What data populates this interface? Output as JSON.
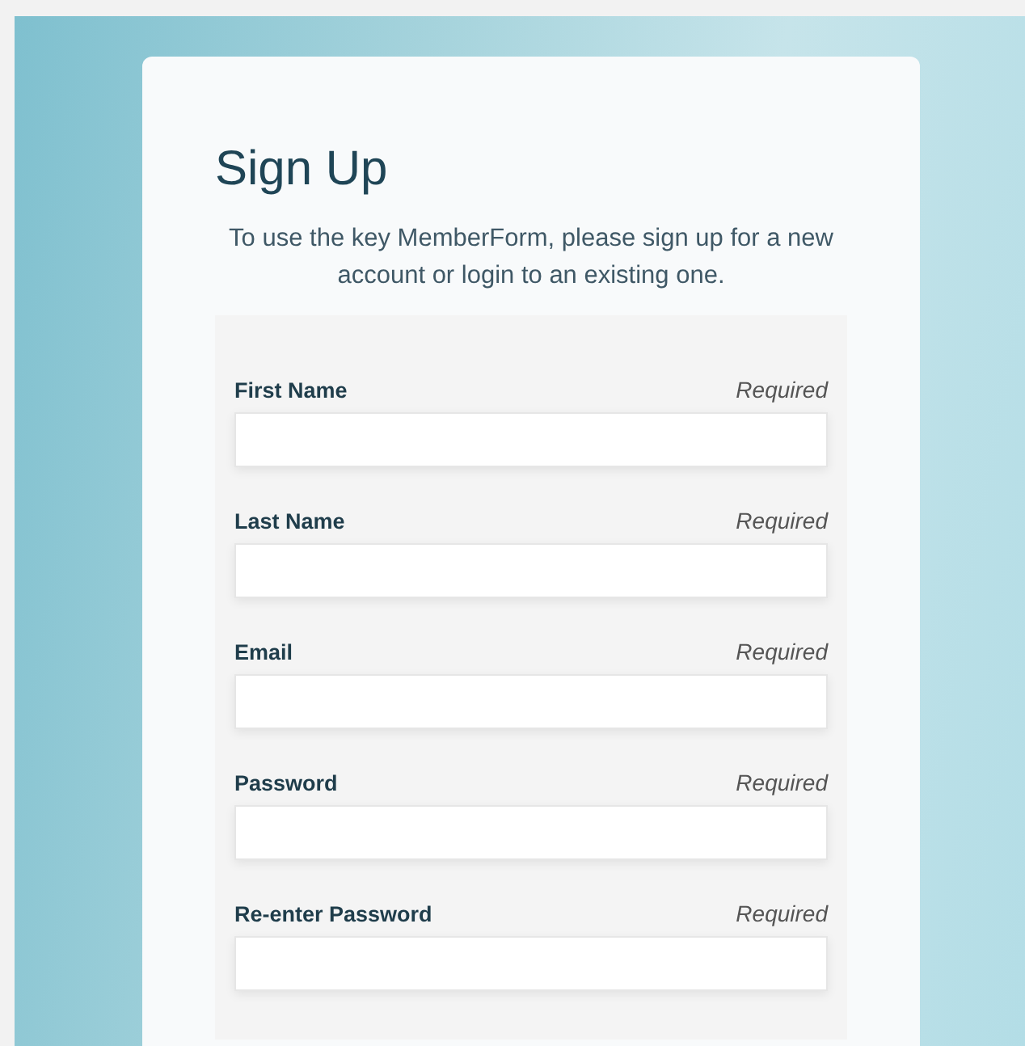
{
  "title": "Sign Up",
  "intro": "To use the key MemberForm, please sign up for a new account or login to an existing one.",
  "fields": [
    {
      "label": "First Name",
      "hint": "Required"
    },
    {
      "label": "Last Name",
      "hint": "Required"
    },
    {
      "label": "Email",
      "hint": "Required"
    },
    {
      "label": "Password",
      "hint": "Required"
    },
    {
      "label": "Re-enter Password",
      "hint": "Required"
    }
  ]
}
